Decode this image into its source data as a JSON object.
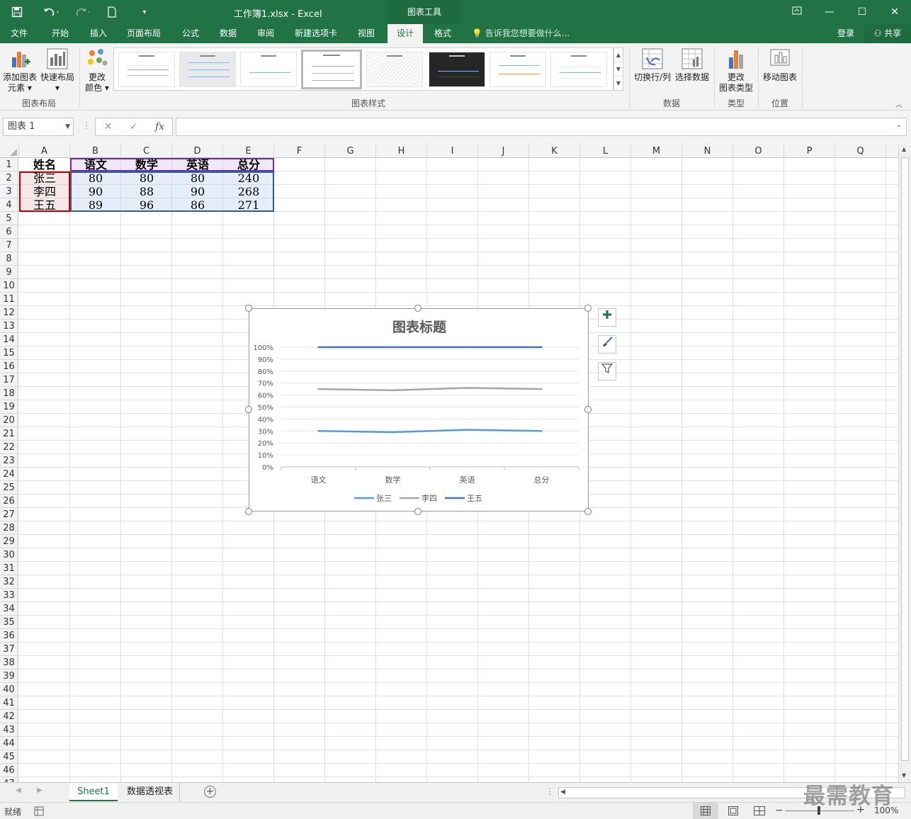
{
  "titlebar": {
    "document_title": "工作簿1.xlsx - Excel",
    "context_tab": "图表工具",
    "save_icon": "save-icon",
    "undo_icon": "undo-icon",
    "redo_icon": "redo-icon",
    "new_icon": "new-document-icon"
  },
  "tabs": [
    "文件",
    "开始",
    "插入",
    "页面布局",
    "公式",
    "数据",
    "审阅",
    "新建选项卡",
    "视图",
    "设计",
    "格式"
  ],
  "active_tab": "设计",
  "tell_me": "告诉我您想要做什么...",
  "login": "登录",
  "share": "共享",
  "ribbon": {
    "add_element_line1": "添加图表",
    "add_element_line2": "元素",
    "quick_layout": "快速布局",
    "change_color_line1": "更改",
    "change_color_line2": "颜色",
    "group_layout": "图表布局",
    "group_styles": "图表样式",
    "switch_row_col": "切换行/列",
    "select_data": "选择数据",
    "group_data": "数据",
    "change_type_line1": "更改",
    "change_type_line2": "图表类型",
    "group_type": "类型",
    "move_chart": "移动图表",
    "group_location": "位置"
  },
  "name_box": "图表 1",
  "formula_value": "",
  "columns": [
    "A",
    "B",
    "C",
    "D",
    "E",
    "F",
    "G",
    "H",
    "I",
    "J",
    "K",
    "L",
    "M",
    "N",
    "O",
    "P",
    "Q"
  ],
  "table": {
    "header": [
      "姓名",
      "语文",
      "数学",
      "英语",
      "总分"
    ],
    "rows": [
      [
        "张三",
        "80",
        "80",
        "80",
        "240"
      ],
      [
        "李四",
        "90",
        "88",
        "90",
        "268"
      ],
      [
        "王五",
        "89",
        "96",
        "86",
        "271"
      ]
    ]
  },
  "chart_data": {
    "type": "line",
    "title": "图表标题",
    "categories": [
      "语文",
      "数学",
      "英语",
      "总分"
    ],
    "series": [
      {
        "name": "张三",
        "values": [
          0.3,
          0.29,
          0.31,
          0.3
        ],
        "color": "#5b9bd5"
      },
      {
        "name": "李四",
        "values": [
          0.65,
          0.64,
          0.66,
          0.65
        ],
        "color": "#a5a5a5"
      },
      {
        "name": "王五",
        "values": [
          1.0,
          1.0,
          1.0,
          1.0
        ],
        "color": "#4472c4"
      }
    ],
    "y_ticks": [
      "0%",
      "10%",
      "20%",
      "30%",
      "40%",
      "50%",
      "60%",
      "70%",
      "80%",
      "90%",
      "100%"
    ],
    "ylim": [
      0,
      1
    ],
    "grid": true,
    "legend": "bottom"
  },
  "sheets": [
    "Sheet1",
    "数据透视表"
  ],
  "active_sheet": "Sheet1",
  "status": {
    "ready": "就绪",
    "zoom": "100%"
  },
  "watermark": "最需教育"
}
